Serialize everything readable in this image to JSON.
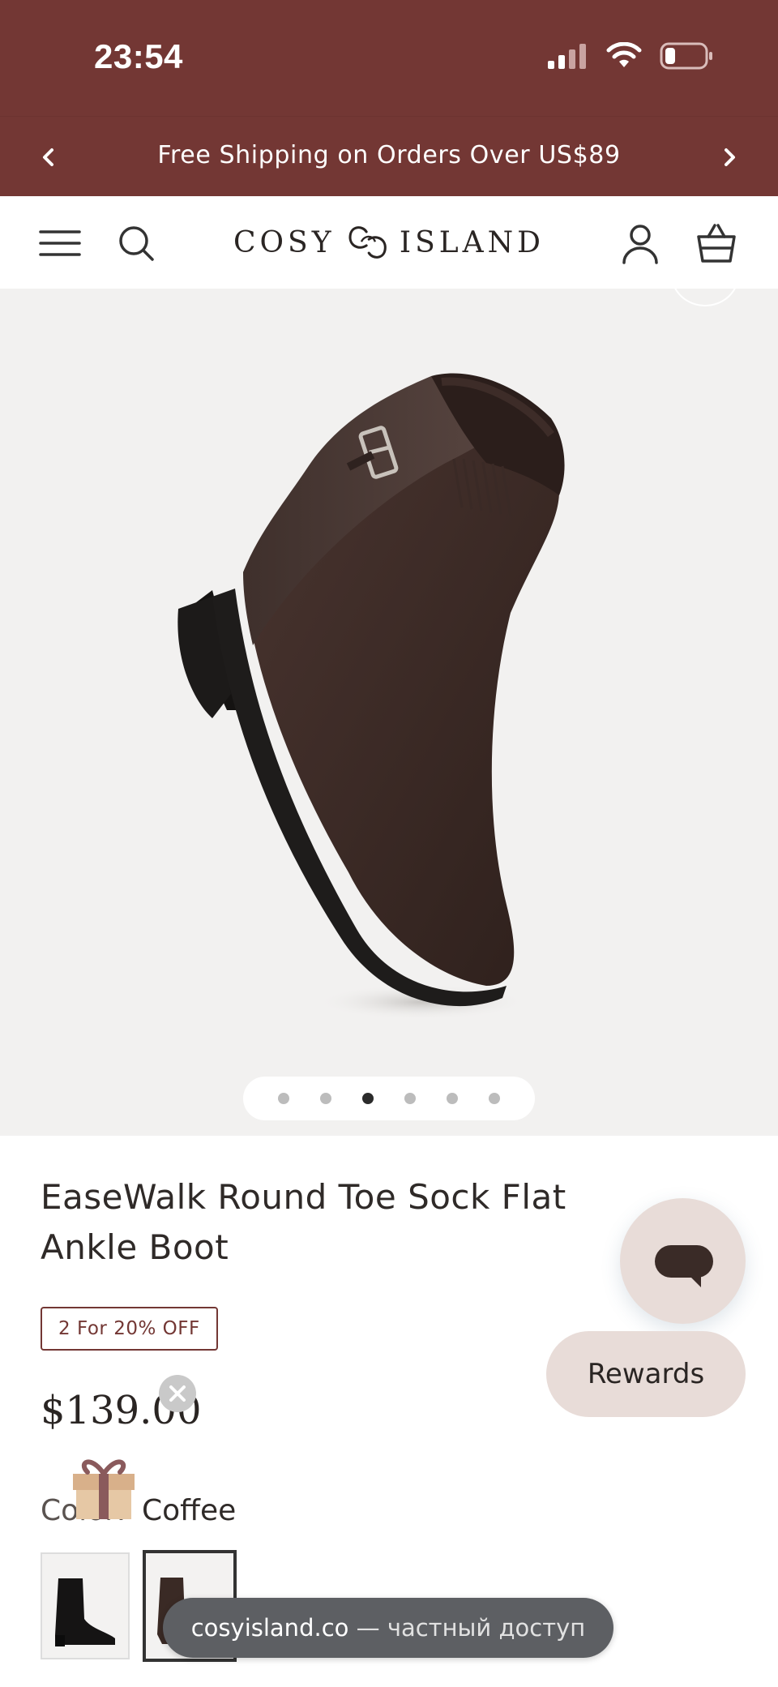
{
  "status_bar": {
    "time": "23:54"
  },
  "announcement": {
    "text": "Free Shipping on Orders Over US$89"
  },
  "header": {
    "logo_left": "COSY",
    "logo_right": "ISLAND"
  },
  "gallery": {
    "slide_count": 6,
    "active_slide": 3
  },
  "product": {
    "title": "EaseWalk Round Toe Sock Flat Ankle Boot",
    "promo_badge": "2 For 20% OFF",
    "price": "$139.00",
    "color_label": "Color:",
    "color_value": "Coffee"
  },
  "widgets": {
    "rewards_label": "Rewards"
  },
  "browser": {
    "url_host": "cosyisland.co",
    "url_suffix": " — частный доступ"
  },
  "colors": {
    "brand": "#733734",
    "pill_bg": "#e8dcd8",
    "gallery_bg": "#f2f1f0"
  }
}
